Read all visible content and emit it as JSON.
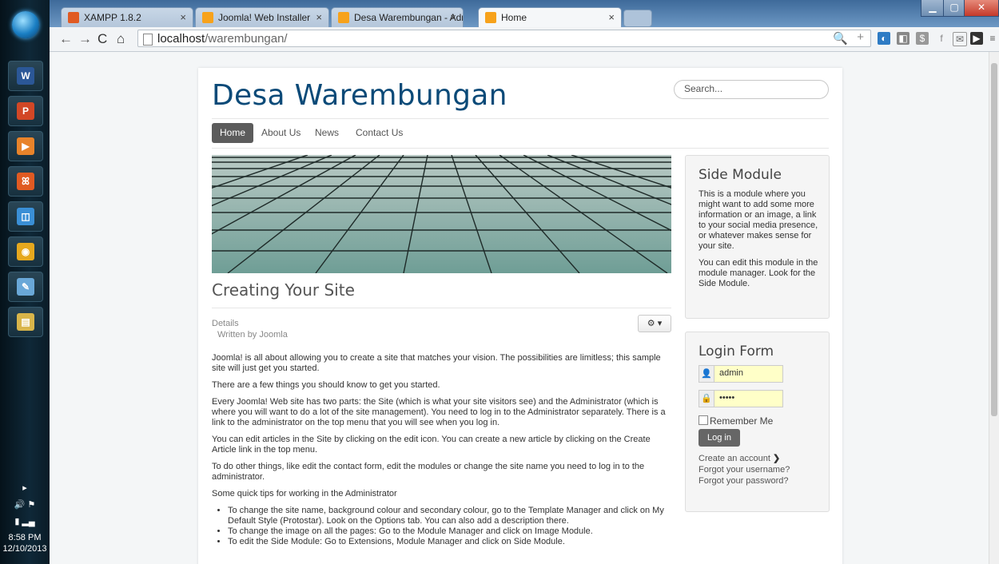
{
  "taskbar": {
    "apps": [
      {
        "name": "word-icon",
        "glyph": "W",
        "color": "#2b5797"
      },
      {
        "name": "powerpoint-icon",
        "glyph": "P",
        "color": "#d24726"
      },
      {
        "name": "media-player-icon",
        "glyph": "▶",
        "color": "#e8832a"
      },
      {
        "name": "xampp-icon",
        "glyph": "ꕤ",
        "color": "#e05a22"
      },
      {
        "name": "control-panel-icon",
        "glyph": "◫",
        "color": "#3a8fd6"
      },
      {
        "name": "chrome-icon",
        "glyph": "◉",
        "color": "#e6a81e"
      },
      {
        "name": "paint-icon",
        "glyph": "✎",
        "color": "#6aa8d8"
      },
      {
        "name": "file-explorer-icon",
        "glyph": "▤",
        "color": "#d9b54a"
      }
    ],
    "clock_time": "8:58 PM",
    "clock_date": "12/10/2013"
  },
  "browser": {
    "tabs": [
      {
        "title": "XAMPP 1.8.2",
        "icon": "xampp-icon"
      },
      {
        "title": "Joomla! Web Installer",
        "icon": "joomla-icon"
      },
      {
        "title": "Desa Warembungan - Adr",
        "icon": "joomla-icon"
      },
      {
        "title": "Home",
        "icon": "joomla-icon",
        "active": true
      }
    ],
    "url_host": "localhost",
    "url_path": "/warembungan/"
  },
  "site": {
    "title": "Desa Warembungan",
    "search_placeholder": "Search...",
    "menu": [
      "Home",
      "About Us",
      "News",
      "Contact Us"
    ],
    "active_menu": "Home"
  },
  "article": {
    "title": "Creating Your Site",
    "details_label": "Details",
    "author": "Written by Joomla",
    "paragraphs": [
      "Joomla! is all about allowing you to create a site that matches your vision. The possibilities are limitless; this sample site will just get you started.",
      "There are a few things you should know to get you started.",
      "Every Joomla! Web site has two parts: the Site (which is what your site visitors see) and the Administrator (which is where you will want to do a lot of the site management). You need to log in to the Administrator separately. There is a link to the administrator on the top menu that you will see when you log in.",
      "You can edit articles in the Site by clicking on the edit icon. You can create a new article by clicking on the Create Article link in the top menu.",
      "To do other things, like edit the contact form, edit the modules or change the site name you need to log in to the administrator.",
      "Some quick tips for working in the Administrator"
    ],
    "tips": [
      "To change the site name, background colour and secondary colour, go to the Template Manager and click on My Default Style (Protostar). Look on the Options tab. You can also add a description there.",
      "To change the image on all the pages: Go to the Module Manager and click on Image Module.",
      "To edit the Side Module: Go to Extensions, Module Manager and click on Side Module."
    ]
  },
  "side_module": {
    "title": "Side Module",
    "paragraphs": [
      "This is a module where you might want to add some more information or an image, a link to your social media presence, or whatever makes sense for your site.",
      "You can edit this module in the module manager. Look for the Side Module."
    ]
  },
  "login": {
    "title": "Login Form",
    "username": "admin",
    "password": "•••••",
    "remember_label": "Remember Me",
    "button": "Log in",
    "links": [
      "Create an account",
      "Forgot your username?",
      "Forgot your password?"
    ]
  }
}
